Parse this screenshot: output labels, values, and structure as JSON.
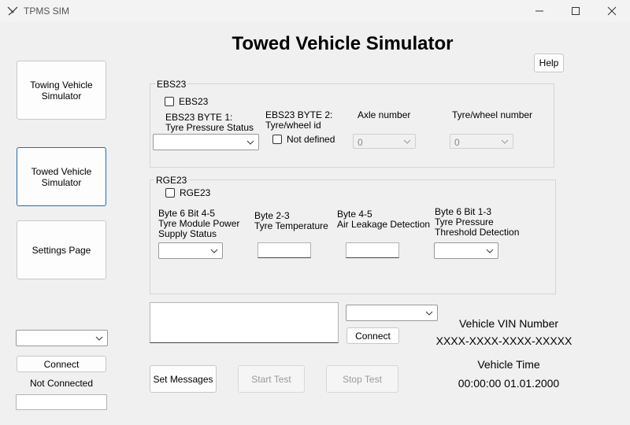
{
  "window": {
    "title": "TPMS SIM"
  },
  "header": {
    "title": "Towed Vehicle Simulator",
    "help_label": "Help"
  },
  "sidebar": {
    "towing_label": "Towing Vehicle Simulator",
    "towed_label": "Towed Vehicle Simulator",
    "settings_label": "Settings Page",
    "connect_label": "Connect",
    "status_text": "Not Connected"
  },
  "ebs23": {
    "group_title": "EBS23",
    "checkbox_label": "EBS23",
    "byte1_label": "EBS23 BYTE 1:\nTyre Pressure Status",
    "byte2_label": "EBS23 BYTE 2:\nTyre/wheel id",
    "not_defined_label": "Not defined",
    "axle_label": "Axle number",
    "axle_value": "0",
    "tyre_label": "Tyre/wheel number",
    "tyre_value": "0"
  },
  "rge23": {
    "group_title": "RGE23",
    "checkbox_label": "RGE23",
    "byte6_45_label": "Byte 6 Bit 4-5\nTyre Module Power\nSupply Status",
    "byte23_label": "Byte 2-3\nTyre Temperature",
    "byte45_label": "Byte 4-5\nAir Leakage Detection",
    "byte6_13_label": "Byte 6 Bit 1-3\nTyre Pressure\nThreshold Detection"
  },
  "controls": {
    "connect_label": "Connect",
    "set_messages_label": "Set Messages",
    "start_test_label": "Start Test",
    "stop_test_label": "Stop Test"
  },
  "vehicle": {
    "vin_label": "Vehicle VIN Number",
    "vin_value": "XXXX-XXXX-XXXX-XXXXX",
    "time_label": "Vehicle Time",
    "time_value": "00:00:00 01.01.2000"
  },
  "icons": {
    "app": "app-logo-icon",
    "minimize": "minimize-icon",
    "maximize": "maximize-icon",
    "close": "close-icon",
    "dropdown": "chevron-down-icon"
  },
  "colors": {
    "focus_border": "#1f6fb5",
    "window_bg": "#f0f0f0"
  }
}
